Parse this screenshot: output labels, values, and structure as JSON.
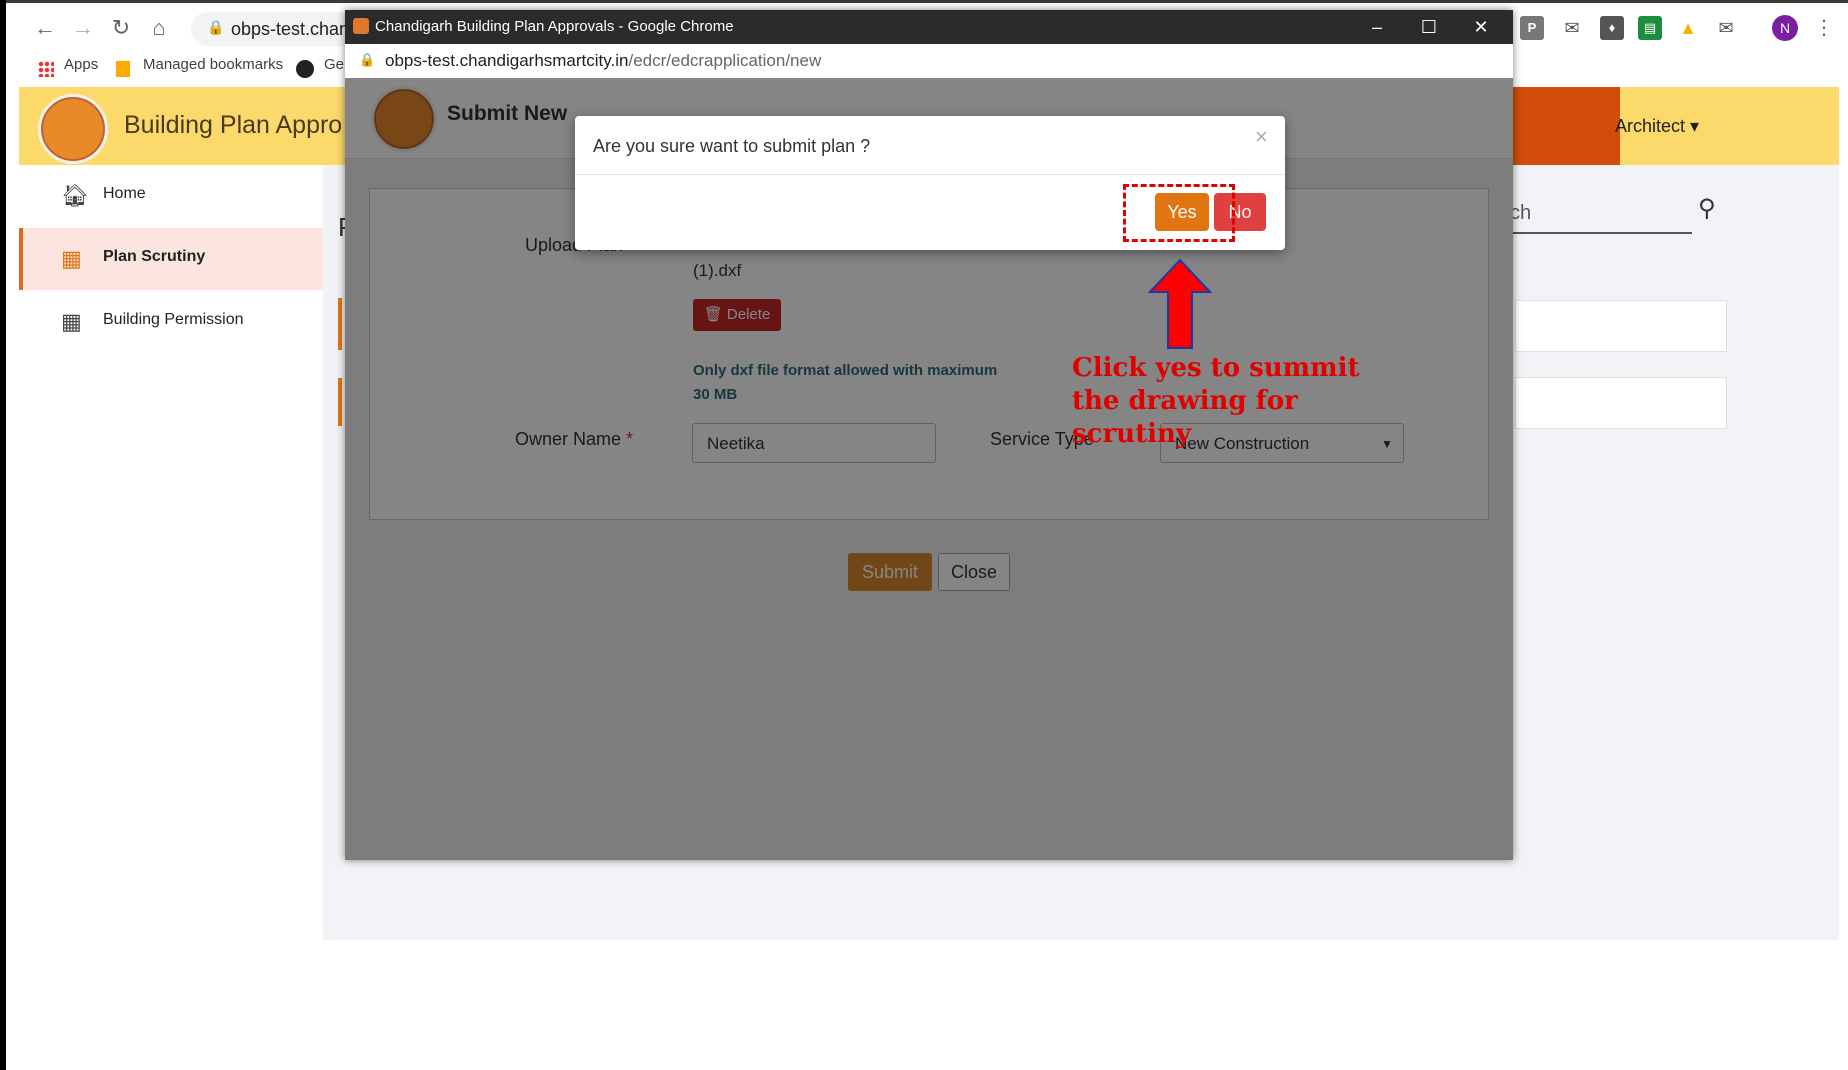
{
  "browser": {
    "url_short": "obps-test.chand",
    "bookmarks": {
      "apps": "Apps",
      "managed": "Managed bookmarks",
      "ge": "Ge"
    },
    "profile_initial": "N"
  },
  "app": {
    "title": "Building Plan Appro",
    "user_menu": "Architect",
    "search_placeholder": "ch",
    "sidebar": [
      {
        "label": "Home",
        "icon": "home-icon"
      },
      {
        "label": "Plan Scrutiny",
        "icon": "building-icon"
      },
      {
        "label": "Building Permission",
        "icon": "building-icon"
      }
    ],
    "partial_heading": "P"
  },
  "popup": {
    "window_title": "Chandigarh Building Plan Approvals - Google Chrome",
    "url_host": "obps-test.chandigarhsmartcity.in",
    "url_path": "/edcr/edcrapplication/new",
    "header_title": "Submit New",
    "form": {
      "upload_label": "Upload Plan",
      "file_name": "(1).dxf",
      "delete_label": "Delete",
      "hint": "Only dxf file format allowed with maximum 30 MB",
      "owner_label": "Owner Name",
      "owner_value": "Neetika",
      "service_label": "Service Type",
      "service_value": "New Construction",
      "submit_label": "Submit",
      "close_label": "Close"
    }
  },
  "modal": {
    "question": "Are you sure want to submit plan ?",
    "yes_label": "Yes",
    "no_label": "No"
  },
  "annotation": {
    "text": "Click yes to summit the drawing for scrutiny"
  },
  "colors": {
    "accent_orange": "#e07512",
    "danger_red": "#e04040",
    "header_yellow": "#fcd96b",
    "annotation_red": "#e00000"
  }
}
